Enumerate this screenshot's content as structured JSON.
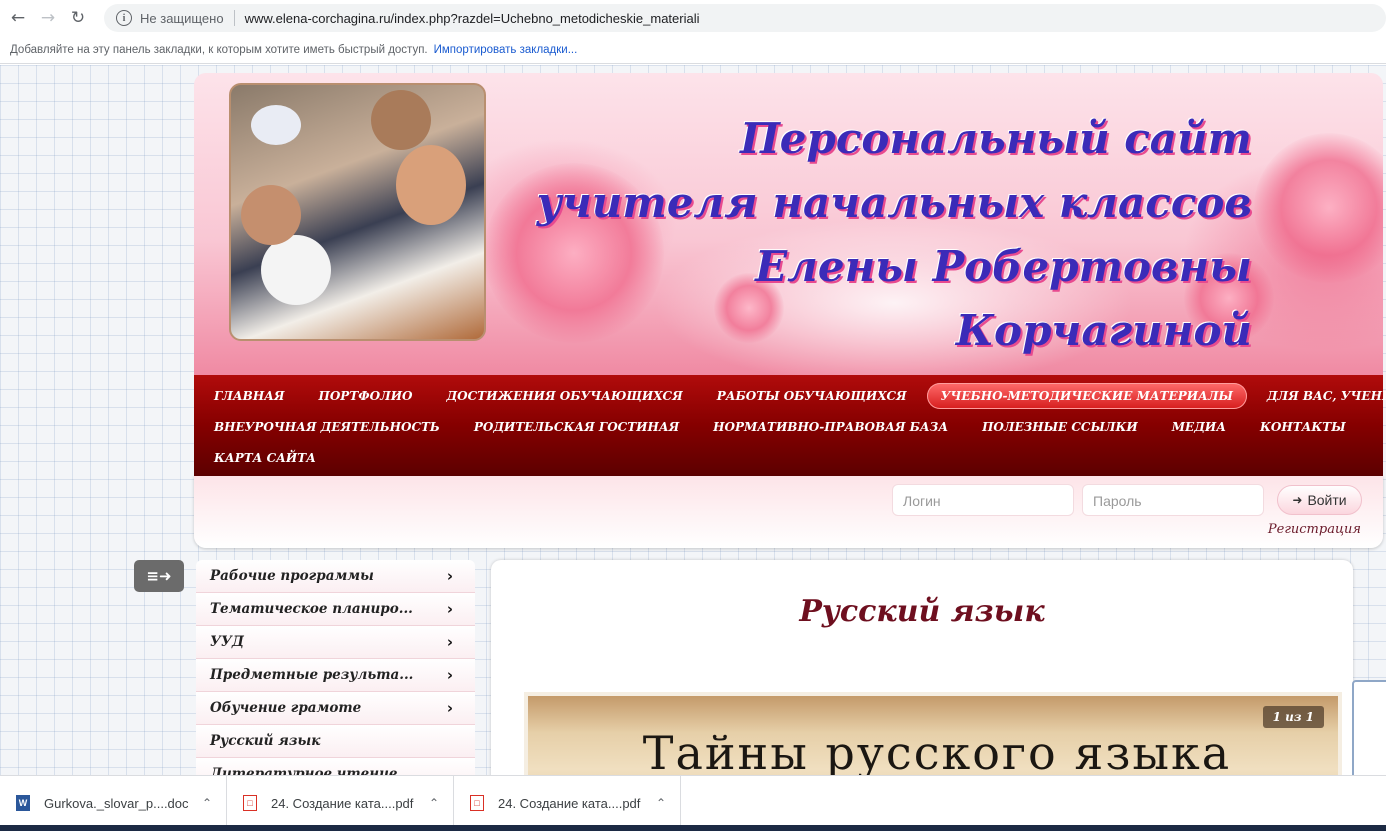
{
  "browser": {
    "security_label": "Не защищено",
    "url": "www.elena-corchagina.ru/index.php?razdel=Uchebno_metodicheskie_materiali",
    "bookmarks_hint": "Добавляйте на эту панель закладки, к которым хотите иметь быстрый доступ.",
    "bookmarks_import": "Импортировать закладки..."
  },
  "site": {
    "title_lines": [
      "Персональный сайт",
      "учителя начальных классов",
      "Елены Робертовны",
      "Корчагиной"
    ],
    "menu": {
      "row1": [
        "ГЛАВНАЯ",
        "ПОРТФОЛИО",
        "ДОСТИЖЕНИЯ ОБУЧАЮЩИХСЯ",
        "РАБОТЫ ОБУЧАЮЩИХСЯ",
        "УЧЕБНО-МЕТОДИЧЕСКИЕ МАТЕРИАЛЫ",
        "ДЛЯ ВАС, УЧЕНИКИ!"
      ],
      "row2": [
        "ВНЕУРОЧНАЯ ДЕЯТЕЛЬНОСТЬ",
        "РОДИТЕЛЬСКАЯ ГОСТИНАЯ",
        "НОРМАТИВНО-ПРАВОВАЯ БАЗА",
        "ПОЛЕЗНЫЕ ССЫЛКИ",
        "МЕДИА",
        "КОНТАКТЫ"
      ],
      "row3": [
        "КАРТА САЙТА"
      ],
      "active": "УЧЕБНО-МЕТОДИЧЕСКИЕ МАТЕРИАЛЫ"
    },
    "login": {
      "login_placeholder": "Логин",
      "password_placeholder": "Пароль",
      "submit": "Войти",
      "register": "Регистрация"
    },
    "sidebar": [
      {
        "label": "Рабочие программы",
        "has_children": true
      },
      {
        "label": "Тематическое планиро...",
        "has_children": true
      },
      {
        "label": "УУД",
        "has_children": true
      },
      {
        "label": "Предметные результа...",
        "has_children": true
      },
      {
        "label": "Обучение грамоте",
        "has_children": true
      },
      {
        "label": "Русский язык",
        "has_children": false
      },
      {
        "label": "Литературное чтение",
        "has_children": false
      }
    ],
    "content": {
      "title": "Русский язык",
      "slide_text": "Тайны русского языка",
      "slide_counter": "1 из 1"
    }
  },
  "downloads": [
    {
      "name": "Gurkova._slovar_p....doc",
      "type": "doc"
    },
    {
      "name": "24. Создание ката....pdf",
      "type": "pdf"
    },
    {
      "name": "24. Создание ката....pdf",
      "type": "pdf"
    }
  ],
  "colors": {
    "menu_bg": "#850000",
    "title_color": "#3b2bb8",
    "content_title": "#6e0f1f"
  }
}
